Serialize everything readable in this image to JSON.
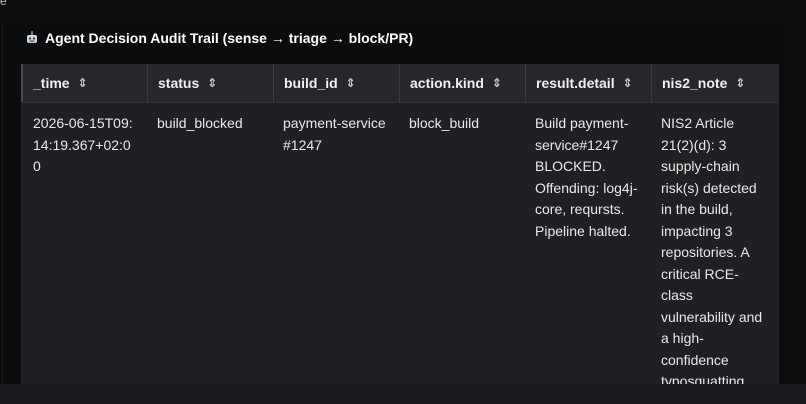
{
  "panel": {
    "title": "Agent Decision Audit Trail (sense → triage → block/PR)",
    "icon": "robot-icon"
  },
  "table": {
    "columns": [
      {
        "label": "_time",
        "sort_icon": "sort-icon"
      },
      {
        "label": "status",
        "sort_icon": "sort-icon"
      },
      {
        "label": "build_id",
        "sort_icon": "sort-icon"
      },
      {
        "label": "action.kind",
        "sort_icon": "sort-icon"
      },
      {
        "label": "result.detail",
        "sort_icon": "sort-icon"
      },
      {
        "label": "nis2_note",
        "sort_icon": "sort-icon"
      }
    ],
    "rows": [
      {
        "time": "2026-06-15T09:14:19.367+02:00",
        "status": "build_blocked",
        "build_id": "payment-service#1247",
        "action_kind": "block_build",
        "result_detail": "Build payment-service#1247 BLOCKED. Offending: log4j-core, reqursts. Pipeline halted.",
        "nis2_note": "NIS2 Article 21(2)(d): 3 supply-chain risk(s) detected in the build, impacting 3 repositories. A critical RCE-class vulnerability and a high-confidence typosquatting"
      }
    ]
  },
  "colors": {
    "background": "#0c0d0f",
    "header_bg": "#26272b",
    "row_bg": "#1f2024",
    "text": "#e9e9e9"
  }
}
